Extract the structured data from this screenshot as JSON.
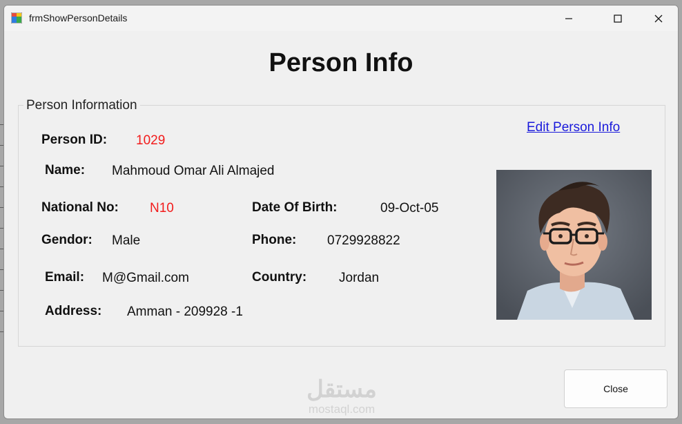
{
  "window": {
    "title": "frmShowPersonDetails"
  },
  "controls": {
    "minimize": "—",
    "maximize": "☐",
    "close": "✕"
  },
  "heading": "Person Info",
  "group": {
    "title": "Person Information",
    "edit_link": "Edit Person Info"
  },
  "fields": {
    "person_id": {
      "label": "Person ID:",
      "value": "1029"
    },
    "name": {
      "label": "Name:",
      "value": "Mahmoud Omar Ali Almajed"
    },
    "national_no": {
      "label": "National No:",
      "value": "N10"
    },
    "date_of_birth": {
      "label": "Date Of Birth:",
      "value": "09-Oct-05"
    },
    "gendor": {
      "label": "Gendor:",
      "value": "Male"
    },
    "phone": {
      "label": "Phone:",
      "value": "0729928822"
    },
    "email": {
      "label": "Email:",
      "value": "M@Gmail.com"
    },
    "country": {
      "label": "Country:",
      "value": "Jordan"
    },
    "address": {
      "label": "Address:",
      "value": "Amman - 209928 -1"
    }
  },
  "buttons": {
    "close": "Close"
  },
  "watermark": {
    "arabic": "مستقل",
    "latin": "mostaql.com"
  },
  "colors": {
    "accent_red": "#f21b1b",
    "link_blue": "#1a1adb"
  }
}
